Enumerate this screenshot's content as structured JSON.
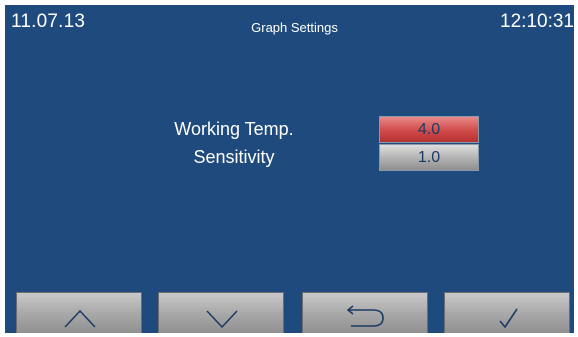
{
  "header": {
    "date": "11.07.13",
    "title": "Graph Settings",
    "time": "12:10:31"
  },
  "settings": [
    {
      "label": "Working Temp.",
      "value": "4.0",
      "state": "selected"
    },
    {
      "label": "Sensitivity",
      "value": "1.0",
      "state": "normal"
    }
  ],
  "nav_buttons": [
    {
      "icon": "arrow-up-icon"
    },
    {
      "icon": "arrow-down-icon"
    },
    {
      "icon": "back-arrow-icon"
    },
    {
      "icon": "checkmark-icon"
    }
  ],
  "colors": {
    "screen_background": "#1f4a7d",
    "selected_value": "#d04a4a",
    "normal_value": "#b0b0b0",
    "text": "#ffffff",
    "icon_color": "#1c3b66"
  }
}
